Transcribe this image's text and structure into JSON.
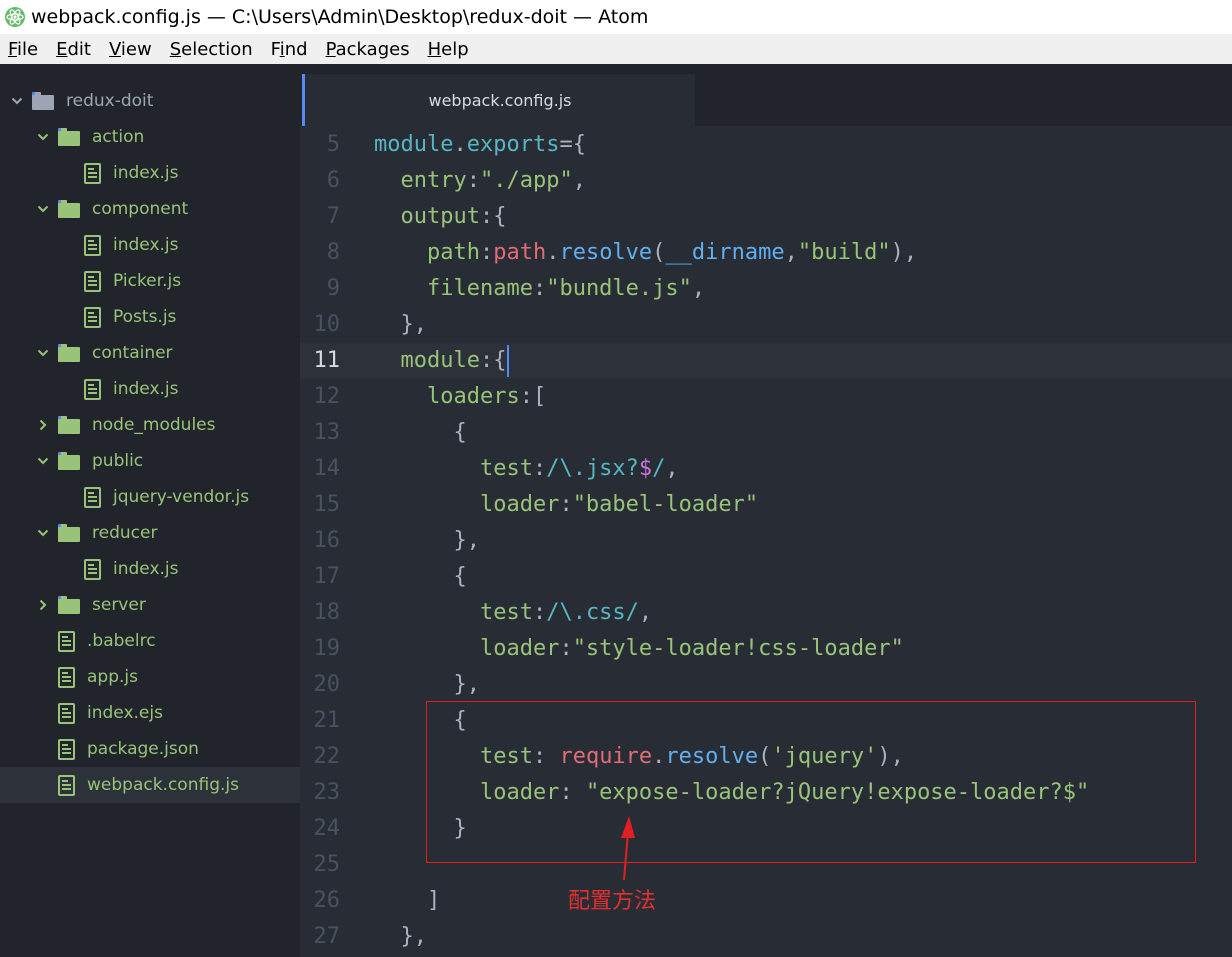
{
  "window": {
    "title": "webpack.config.js — C:\\Users\\Admin\\Desktop\\redux-doit — Atom",
    "app_icon": "atom-icon"
  },
  "menu": [
    {
      "u": "F",
      "rest": "ile"
    },
    {
      "u": "E",
      "rest": "dit"
    },
    {
      "u": "V",
      "rest": "iew"
    },
    {
      "u": "S",
      "rest": "election"
    },
    {
      "pre": "F",
      "u": "i",
      "rest": "nd"
    },
    {
      "u": "P",
      "rest": "ackages"
    },
    {
      "u": "H",
      "rest": "elp"
    }
  ],
  "tree": [
    {
      "label": "redux-doit",
      "kind": "root",
      "expanded": true
    },
    {
      "label": "action",
      "kind": "folder",
      "expanded": true
    },
    {
      "label": "index.js",
      "kind": "file"
    },
    {
      "label": "component",
      "kind": "folder",
      "expanded": true
    },
    {
      "label": "index.js",
      "kind": "file"
    },
    {
      "label": "Picker.js",
      "kind": "file"
    },
    {
      "label": "Posts.js",
      "kind": "file"
    },
    {
      "label": "container",
      "kind": "folder",
      "expanded": true
    },
    {
      "label": "index.js",
      "kind": "file"
    },
    {
      "label": "node_modules",
      "kind": "folder",
      "expanded": false
    },
    {
      "label": "public",
      "kind": "folder",
      "expanded": true
    },
    {
      "label": "jquery-vendor.js",
      "kind": "file"
    },
    {
      "label": "reducer",
      "kind": "folder",
      "expanded": true
    },
    {
      "label": "index.js",
      "kind": "file"
    },
    {
      "label": "server",
      "kind": "folder",
      "expanded": false
    },
    {
      "label": ".babelrc",
      "kind": "file"
    },
    {
      "label": "app.js",
      "kind": "file"
    },
    {
      "label": "index.ejs",
      "kind": "file"
    },
    {
      "label": "package.json",
      "kind": "file"
    },
    {
      "label": "webpack.config.js",
      "kind": "file",
      "selected": true
    }
  ],
  "active_tab": "webpack.config.js",
  "current_line": "11",
  "code_lines": [
    {
      "n": "5",
      "t": [
        [
          "module",
          "k-obj"
        ],
        [
          ".",
          "k-plain"
        ],
        [
          "exports",
          "k-obj"
        ],
        [
          "={",
          "k-plain"
        ]
      ]
    },
    {
      "n": "6",
      "t": [
        [
          "  entry",
          "k-attr"
        ],
        [
          ":",
          "k-plain"
        ],
        [
          "\"./app\"",
          "k-str"
        ],
        [
          ",",
          "k-plain"
        ]
      ]
    },
    {
      "n": "7",
      "t": [
        [
          "  output",
          "k-attr"
        ],
        [
          ":{",
          "k-plain"
        ]
      ]
    },
    {
      "n": "8",
      "t": [
        [
          "    path",
          "k-attr"
        ],
        [
          ":",
          "k-plain"
        ],
        [
          "path",
          "k-var"
        ],
        [
          ".",
          "k-plain"
        ],
        [
          "resolve",
          "k-fn"
        ],
        [
          "(",
          "k-plain"
        ],
        [
          "__dirname",
          "k-fn"
        ],
        [
          ",",
          "k-plain"
        ],
        [
          "\"build\"",
          "k-str"
        ],
        [
          "),",
          "k-plain"
        ]
      ]
    },
    {
      "n": "9",
      "t": [
        [
          "    filename",
          "k-attr"
        ],
        [
          ":",
          "k-plain"
        ],
        [
          "\"bundle.js\"",
          "k-str"
        ],
        [
          ",",
          "k-plain"
        ]
      ]
    },
    {
      "n": "10",
      "t": [
        [
          "  },",
          "k-plain"
        ]
      ]
    },
    {
      "n": "11",
      "t": [
        [
          "  module",
          "k-attr"
        ],
        [
          ":{",
          "k-plain"
        ]
      ],
      "cursor": true
    },
    {
      "n": "12",
      "t": [
        [
          "    loaders",
          "k-attr"
        ],
        [
          ":[",
          "k-plain"
        ]
      ]
    },
    {
      "n": "13",
      "t": [
        [
          "      {",
          "k-plain"
        ]
      ]
    },
    {
      "n": "14",
      "t": [
        [
          "        test",
          "k-attr"
        ],
        [
          ":",
          "k-plain"
        ],
        [
          "/\\.jsx?",
          "k-re"
        ],
        [
          "$",
          "k-re2"
        ],
        [
          "/",
          "k-re"
        ],
        [
          ",",
          "k-plain"
        ]
      ]
    },
    {
      "n": "15",
      "t": [
        [
          "        loader",
          "k-attr"
        ],
        [
          ":",
          "k-plain"
        ],
        [
          "\"babel-loader\"",
          "k-str"
        ]
      ]
    },
    {
      "n": "16",
      "t": [
        [
          "      },",
          "k-plain"
        ]
      ]
    },
    {
      "n": "17",
      "t": [
        [
          "      {",
          "k-plain"
        ]
      ]
    },
    {
      "n": "18",
      "t": [
        [
          "        test",
          "k-attr"
        ],
        [
          ":",
          "k-plain"
        ],
        [
          "/\\.css/",
          "k-re"
        ],
        [
          ",",
          "k-plain"
        ]
      ]
    },
    {
      "n": "19",
      "t": [
        [
          "        loader",
          "k-attr"
        ],
        [
          ":",
          "k-plain"
        ],
        [
          "\"style-loader!css-loader\"",
          "k-str"
        ]
      ]
    },
    {
      "n": "20",
      "t": [
        [
          "      },",
          "k-plain"
        ]
      ]
    },
    {
      "n": "21",
      "t": [
        [
          "      {",
          "k-plain"
        ]
      ]
    },
    {
      "n": "22",
      "t": [
        [
          "        test",
          "k-attr"
        ],
        [
          ": ",
          "k-plain"
        ],
        [
          "require",
          "k-var"
        ],
        [
          ".",
          "k-plain"
        ],
        [
          "resolve",
          "k-fn"
        ],
        [
          "(",
          "k-plain"
        ],
        [
          "'jquery'",
          "k-str"
        ],
        [
          "),",
          "k-plain"
        ]
      ]
    },
    {
      "n": "23",
      "t": [
        [
          "        loader",
          "k-attr"
        ],
        [
          ": ",
          "k-plain"
        ],
        [
          "\"expose-loader?jQuery!expose-loader?$\"",
          "k-str"
        ]
      ]
    },
    {
      "n": "24",
      "t": [
        [
          "      }",
          "k-plain"
        ]
      ]
    },
    {
      "n": "25",
      "t": []
    },
    {
      "n": "26",
      "t": [
        [
          "    ]",
          "k-plain"
        ]
      ]
    },
    {
      "n": "27",
      "t": [
        [
          "  },",
          "k-plain"
        ]
      ]
    }
  ],
  "annotation": {
    "text": "配置方法"
  },
  "colors": {
    "folder": "#98c379",
    "root_folder": "#9da5b4",
    "selection": "#2c313a",
    "cursor": "#528bff",
    "annotation": "#e03030"
  }
}
